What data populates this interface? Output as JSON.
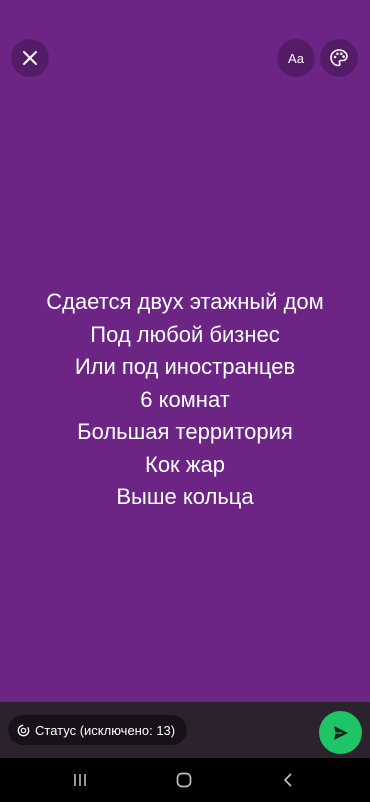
{
  "toolbar": {
    "close_icon": "close-icon",
    "font_label": "Aa",
    "palette_icon": "palette-icon"
  },
  "status": {
    "background_color": "#6c2485",
    "lines": [
      "Сдается двух этажный дом",
      "Под любой бизнес",
      "Или под иностранцев",
      "6 комнат",
      "Большая территория",
      "Кок жар",
      "Выше кольца"
    ]
  },
  "footer": {
    "audience_label": "Статус (исключено: 13)",
    "audience_icon": "status-privacy-icon",
    "send_icon": "send-icon",
    "send_color": "#1ec466"
  },
  "navigation": {
    "recent_icon": "recent-apps-icon",
    "home_icon": "home-icon",
    "back_icon": "back-icon"
  }
}
